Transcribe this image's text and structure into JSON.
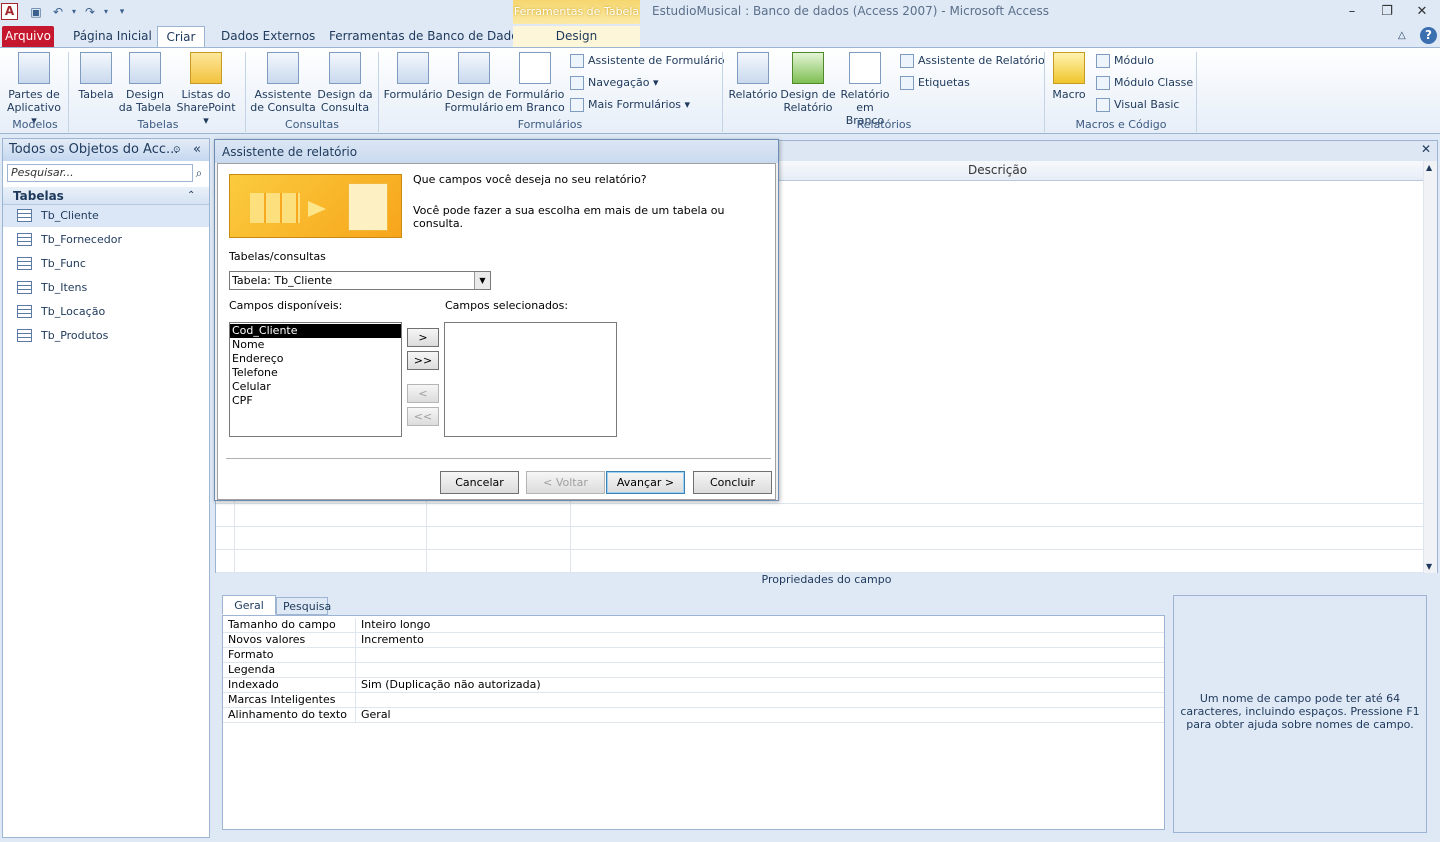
{
  "window": {
    "title": "EstudioMusical : Banco de dados (Access 2007)  -  Microsoft Access",
    "context_tab_header": "Ferramentas de Tabela"
  },
  "quick_access": {
    "app_icon": "A"
  },
  "tabs": {
    "arquivo": "Arquivo",
    "pagina_inicial": "Página Inicial",
    "criar": "Criar",
    "dados_externos": "Dados Externos",
    "ferramentas": "Ferramentas de Banco de Dados",
    "design": "Design"
  },
  "ribbon": {
    "modelos": {
      "label": "Modelos",
      "partes": "Partes de",
      "partes2": "Aplicativo ▾"
    },
    "tabelas": {
      "label": "Tabelas",
      "tabela": "Tabela",
      "design1": "Design",
      "design2": "da Tabela",
      "listas1": "Listas do",
      "listas2": "SharePoint ▾"
    },
    "consultas": {
      "label": "Consultas",
      "assist1": "Assistente",
      "assist2": "de Consulta",
      "design1": "Design da",
      "design2": "Consulta"
    },
    "formularios": {
      "label": "Formulários",
      "form": "Formulário",
      "design1": "Design de",
      "design2": "Formulário",
      "branco1": "Formulário",
      "branco2": "em Branco",
      "assistente": "Assistente de Formulário",
      "navegacao": "Navegação ▾",
      "mais": "Mais Formulários ▾"
    },
    "relatorios": {
      "label": "Relatórios",
      "rel": "Relatório",
      "design1": "Design de",
      "design2": "Relatório",
      "branco1": "Relatório",
      "branco2": "em Branco",
      "assistente": "Assistente de Relatório",
      "etiquetas": "Etiquetas"
    },
    "macros": {
      "label": "Macros e Código",
      "macro": "Macro",
      "modulo": "Módulo",
      "classe": "Módulo Classe",
      "vb": "Visual Basic"
    }
  },
  "nav": {
    "header": "Todos os Objetos do Acc...",
    "search_placeholder": "Pesquisar...",
    "group": "Tabelas",
    "items": [
      {
        "label": "Tb_Cliente"
      },
      {
        "label": "Tb_Fornecedor"
      },
      {
        "label": "Tb_Func"
      },
      {
        "label": "Tb_Itens"
      },
      {
        "label": "Tb_Locação"
      },
      {
        "label": "Tb_Produtos"
      }
    ]
  },
  "designer": {
    "col_descricao": "Descrição"
  },
  "properties": {
    "title": "Propriedades do campo",
    "tab_geral": "Geral",
    "tab_pesquisa": "Pesquisa",
    "rows": [
      {
        "k": "Tamanho do campo",
        "v": "Inteiro longo"
      },
      {
        "k": "Novos valores",
        "v": "Incremento"
      },
      {
        "k": "Formato",
        "v": ""
      },
      {
        "k": "Legenda",
        "v": ""
      },
      {
        "k": "Indexado",
        "v": "Sim (Duplicação não autorizada)"
      },
      {
        "k": "Marcas Inteligentes",
        "v": ""
      },
      {
        "k": "Alinhamento do texto",
        "v": "Geral"
      }
    ],
    "help": "Um nome de campo pode ter até 64 caracteres, incluindo espaços. Pressione F1 para obter ajuda sobre nomes de campo."
  },
  "dialog": {
    "title": "Assistente de relatório",
    "question": "Que campos você deseja no seu relatório?",
    "hint": "Você pode fazer a sua escolha em mais de um tabela ou consulta.",
    "tables_label": "Tabelas/consultas",
    "combo_value": "Tabela: Tb_Cliente",
    "available_label": "Campos disponíveis:",
    "selected_label": "Campos selecionados:",
    "available_fields": [
      "Cod_Cliente",
      "Nome",
      "Endereço",
      "Telefone",
      "Celular",
      "CPF"
    ],
    "move_one": ">",
    "move_all": ">>",
    "remove_one": "<",
    "remove_all": "<<",
    "cancelar": "Cancelar",
    "voltar": "< Voltar",
    "avancar": "Avançar >",
    "concluir": "Concluir"
  }
}
